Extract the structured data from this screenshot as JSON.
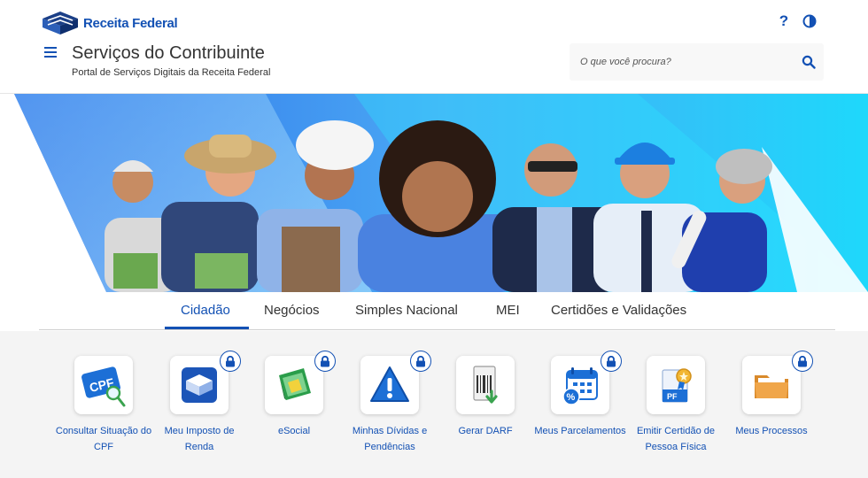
{
  "header": {
    "logo_text": "Receita Federal",
    "title": "Serviços do Contribuinte",
    "subtitle": "Portal de Serviços Digitais da Receita Federal",
    "help_label": "?",
    "search_placeholder": "O que você procura?"
  },
  "colors": {
    "brand": "#1351b4",
    "accent_cyan": "#21d4fd",
    "banner_blue": "#2f80ed"
  },
  "tabs": [
    {
      "label": "Cidadão",
      "active": true
    },
    {
      "label": "Negócios",
      "active": false
    },
    {
      "label": "Simples Nacional",
      "active": false
    },
    {
      "label": "MEI",
      "active": false
    },
    {
      "label": "Certidões e Validações",
      "active": false
    }
  ],
  "services": [
    {
      "label": "Consultar Situação do CPF",
      "icon": "cpf-search-icon",
      "locked": false
    },
    {
      "label": "Meu Imposto de Renda",
      "icon": "income-tax-icon",
      "locked": true
    },
    {
      "label": "eSocial",
      "icon": "esocial-icon",
      "locked": true
    },
    {
      "label": "Minhas Dívidas e Pendências",
      "icon": "warning-icon",
      "locked": true
    },
    {
      "label": "Gerar DARF",
      "icon": "darf-barcode-icon",
      "locked": false
    },
    {
      "label": "Meus Parcelamentos",
      "icon": "calendar-percent-icon",
      "locked": true
    },
    {
      "label": "Emitir Certidão de Pessoa Física",
      "icon": "certificate-icon",
      "locked": false
    },
    {
      "label": "Meus Processos",
      "icon": "folder-icon",
      "locked": true
    }
  ]
}
